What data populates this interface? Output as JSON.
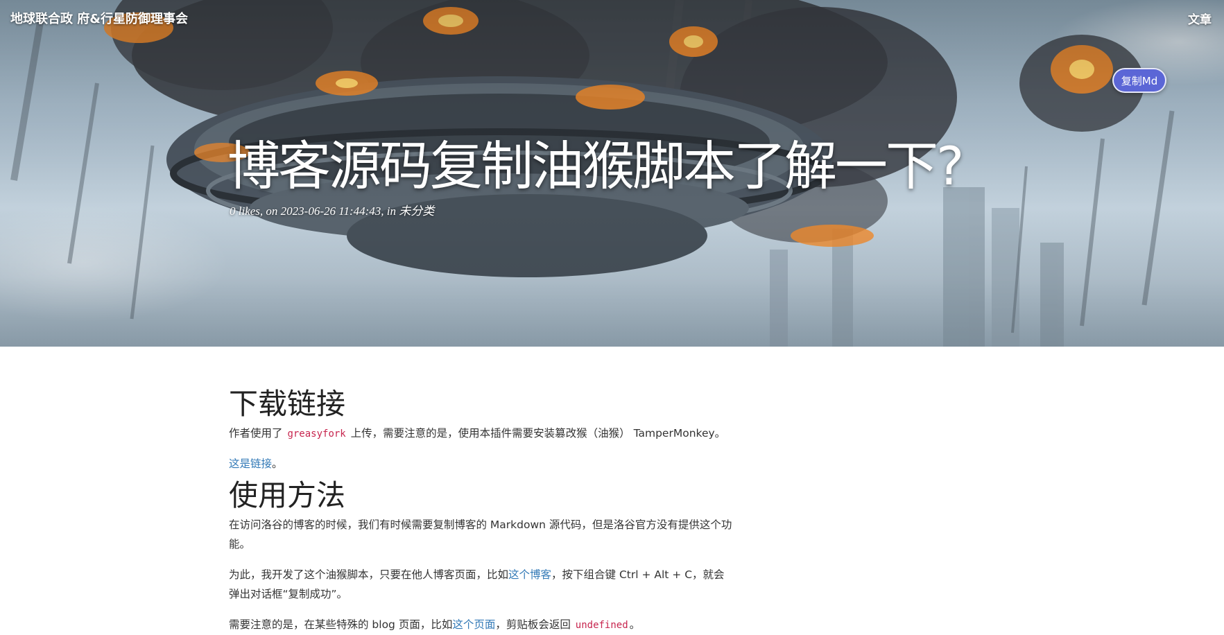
{
  "header": {
    "brand": "地球联合政 府&行星防御理事会",
    "nav_link": "文章"
  },
  "toolbar": {
    "copy_md_label": "复制Md"
  },
  "post": {
    "title": "博客源码复制油猴脚本了解一下?",
    "meta_prefix": "0 likes, on 2023-06-26 11:44:43, in",
    "category": "未分类"
  },
  "article": {
    "section1": {
      "heading": "下载链接",
      "p1_before": "作者使用了 ",
      "p1_code": "greasyfork",
      "p1_after": " 上传，需要注意的是，使用本插件需要安装篡改猴（油猴） TamperMonkey。",
      "p2_link": "这是链接",
      "p2_after": "。"
    },
    "section2": {
      "heading": "使用方法",
      "p1": "在访问洛谷的博客的时候，我们有时候需要复制博客的 Markdown 源代码，但是洛谷官方没有提供这个功能。",
      "p2_before": "为此，我开发了这个油猴脚本，只要在他人博客页面，比如",
      "p2_link": "这个博客",
      "p2_after": "，按下组合键 Ctrl + Alt + C，就会弹出对话框“复制成功”。",
      "p3_before": "需要注意的是，在某些特殊的 blog 页面，比如",
      "p3_link": "这个页面",
      "p3_middle": "，剪贴板会返回 ",
      "p3_code": "undefined",
      "p3_after": "。"
    }
  },
  "colors": {
    "button_bg": "#5b66d6",
    "link": "#337ab7",
    "code": "#c7254e"
  }
}
